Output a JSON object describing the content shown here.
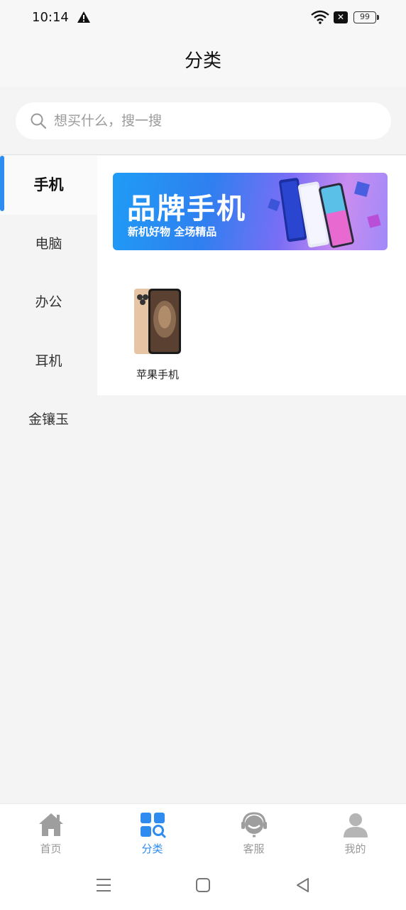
{
  "status": {
    "time": "10:14",
    "battery": "99",
    "x_badge": "✕"
  },
  "header": {
    "title": "分类"
  },
  "search": {
    "placeholder": "想买什么，搜一搜"
  },
  "sidebar": {
    "items": [
      {
        "label": "手机",
        "active": true
      },
      {
        "label": "电脑",
        "active": false
      },
      {
        "label": "办公",
        "active": false
      },
      {
        "label": "耳机",
        "active": false
      },
      {
        "label": "金镶玉",
        "active": false
      }
    ]
  },
  "banner": {
    "title": "品牌手机",
    "subtitle": "新机好物  全场精品"
  },
  "products": [
    {
      "name": "苹果手机",
      "icon": "iphone-image"
    }
  ],
  "tabbar": {
    "items": [
      {
        "label": "首页",
        "icon": "home-icon",
        "active": false
      },
      {
        "label": "分类",
        "icon": "category-search-icon",
        "active": true
      },
      {
        "label": "客服",
        "icon": "customer-service-icon",
        "active": false
      },
      {
        "label": "我的",
        "icon": "user-icon",
        "active": false
      }
    ]
  },
  "colors": {
    "accent": "#2e8cf0",
    "inactive": "#999999",
    "background": "#f4f4f4"
  }
}
